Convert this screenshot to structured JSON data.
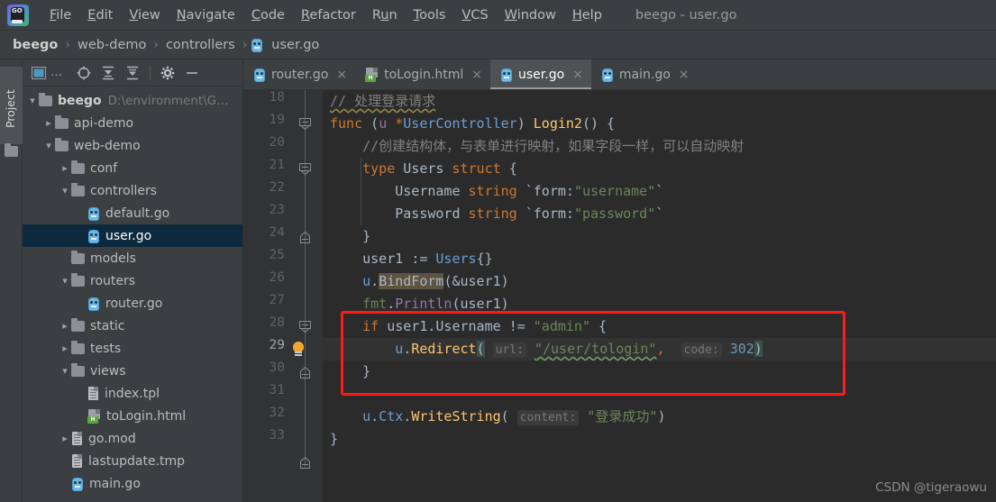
{
  "window": {
    "title": "beego - user.go",
    "app_icon": "goland-logo-icon"
  },
  "menubar": {
    "items": [
      {
        "label": "File",
        "mnemonic": "F"
      },
      {
        "label": "Edit",
        "mnemonic": "E"
      },
      {
        "label": "View",
        "mnemonic": "V"
      },
      {
        "label": "Navigate",
        "mnemonic": "N"
      },
      {
        "label": "Code",
        "mnemonic": "C"
      },
      {
        "label": "Refactor",
        "mnemonic": "R"
      },
      {
        "label": "Run",
        "mnemonic": "u"
      },
      {
        "label": "Tools",
        "mnemonic": "T"
      },
      {
        "label": "VCS",
        "mnemonic": "V"
      },
      {
        "label": "Window",
        "mnemonic": "W"
      },
      {
        "label": "Help",
        "mnemonic": "H"
      }
    ]
  },
  "breadcrumb": {
    "separator": "›",
    "items": [
      {
        "label": "beego",
        "icon": null
      },
      {
        "label": "web-demo",
        "icon": null
      },
      {
        "label": "controllers",
        "icon": null
      },
      {
        "label": "user.go",
        "icon": "go-file-icon"
      }
    ]
  },
  "project_pane": {
    "vertical_tab_label": "Project",
    "toolbar": [
      {
        "name": "project-view-selector",
        "label": "■",
        "extra": "..."
      },
      {
        "name": "locate-in-tree",
        "label": "target-icon"
      },
      {
        "name": "expand-all",
        "label": "expand-all-icon"
      },
      {
        "name": "collapse-all",
        "label": "collapse-all-icon"
      },
      {
        "name": "settings",
        "label": "gear-icon"
      },
      {
        "name": "hide",
        "label": "minimize-icon"
      }
    ],
    "tree": [
      {
        "label": "beego",
        "path": "D:\\environment\\G…",
        "icon": "folder-icon",
        "depth": 0,
        "arrow": "expanded",
        "bold": true,
        "selected": false
      },
      {
        "label": "api-demo",
        "path": "",
        "icon": "folder-icon",
        "depth": 1,
        "arrow": "collapsed",
        "bold": false,
        "selected": false
      },
      {
        "label": "web-demo",
        "path": "",
        "icon": "folder-icon",
        "depth": 1,
        "arrow": "expanded",
        "bold": false,
        "selected": false
      },
      {
        "label": "conf",
        "path": "",
        "icon": "folder-icon",
        "depth": 2,
        "arrow": "collapsed",
        "bold": false,
        "selected": false
      },
      {
        "label": "controllers",
        "path": "",
        "icon": "folder-icon",
        "depth": 2,
        "arrow": "expanded",
        "bold": false,
        "selected": false
      },
      {
        "label": "default.go",
        "path": "",
        "icon": "go-file-icon",
        "depth": 3,
        "arrow": "none",
        "bold": false,
        "selected": false
      },
      {
        "label": "user.go",
        "path": "",
        "icon": "go-file-icon",
        "depth": 3,
        "arrow": "none",
        "bold": false,
        "selected": true
      },
      {
        "label": "models",
        "path": "",
        "icon": "folder-icon",
        "depth": 2,
        "arrow": "none",
        "bold": false,
        "selected": false
      },
      {
        "label": "routers",
        "path": "",
        "icon": "folder-icon",
        "depth": 2,
        "arrow": "expanded",
        "bold": false,
        "selected": false
      },
      {
        "label": "router.go",
        "path": "",
        "icon": "go-file-icon",
        "depth": 3,
        "arrow": "none",
        "bold": false,
        "selected": false
      },
      {
        "label": "static",
        "path": "",
        "icon": "folder-icon",
        "depth": 2,
        "arrow": "collapsed",
        "bold": false,
        "selected": false
      },
      {
        "label": "tests",
        "path": "",
        "icon": "folder-icon",
        "depth": 2,
        "arrow": "collapsed",
        "bold": false,
        "selected": false
      },
      {
        "label": "views",
        "path": "",
        "icon": "folder-icon",
        "depth": 2,
        "arrow": "expanded",
        "bold": false,
        "selected": false
      },
      {
        "label": "index.tpl",
        "path": "",
        "icon": "txt-file-icon",
        "depth": 3,
        "arrow": "none",
        "bold": false,
        "selected": false
      },
      {
        "label": "toLogin.html",
        "path": "",
        "icon": "html-file-icon",
        "depth": 3,
        "arrow": "none",
        "bold": false,
        "selected": false
      },
      {
        "label": "go.mod",
        "path": "",
        "icon": "txt-file-icon",
        "depth": 2,
        "arrow": "collapsed",
        "bold": false,
        "selected": false
      },
      {
        "label": "lastupdate.tmp",
        "path": "",
        "icon": "txt-file-icon",
        "depth": 2,
        "arrow": "none",
        "bold": false,
        "selected": false
      },
      {
        "label": "main.go",
        "path": "",
        "icon": "go-file-icon",
        "depth": 2,
        "arrow": "none",
        "bold": false,
        "selected": false
      }
    ]
  },
  "editor_tabs": [
    {
      "label": "router.go",
      "icon": "go-file-icon",
      "active": false,
      "close": "×"
    },
    {
      "label": "toLogin.html",
      "icon": "html-file-icon",
      "active": false,
      "close": "×"
    },
    {
      "label": "user.go",
      "icon": "go-file-icon",
      "active": true,
      "close": "×"
    },
    {
      "label": "main.go",
      "icon": "go-file-icon",
      "active": false,
      "close": "×"
    }
  ],
  "editor": {
    "current_line": 29,
    "line_numbers": [
      18,
      19,
      20,
      21,
      22,
      23,
      24,
      25,
      26,
      27,
      28,
      29,
      30,
      31,
      32,
      33
    ],
    "lines": {
      "18": "// 处理登录请求",
      "19": "func (u *UserController) Login2() {",
      "20": "    //创建结构体，与表单进行映射，如果字段一样，可以自动映射",
      "21": "    type Users struct {",
      "22": "        Username string `form:\"username\"`",
      "23": "        Password string `form:\"password\"`",
      "24": "    }",
      "25": "    user1 := Users{}",
      "26": "    u.BindForm(&user1)",
      "27": "    fmt.Println(user1)",
      "28": "    if user1.Username != \"admin\" {",
      "29": "        u.Redirect( url: \"/user/tologin\",  code: 302)",
      "30": "    }",
      "31": "",
      "32": "    u.Ctx.WriteString( content: \"登录成功\")",
      "33": "}"
    },
    "tokens": {
      "comment_18": "// 处理登录请求",
      "kw_func": "func",
      "recv_u": "u",
      "star": "*",
      "type_usercontroller": "UserController",
      "method_login2": "Login2",
      "comment_20": "//创建结构体，与表单进行映射，如果字段一样，可以自动映射",
      "kw_type": "type",
      "type_users": "Users",
      "kw_struct": "struct",
      "field_username": "Username",
      "field_password": "Password",
      "kw_string": "string",
      "tag_username": "`form:\"username\"`",
      "tag_password": "`form:\"password\"`",
      "var_user1": "user1",
      "assign": ":=",
      "call_bindform": "BindForm",
      "pkg_fmt": "fmt",
      "fn_println": "Println",
      "kw_if": "if",
      "expr_username": "user1.Username",
      "op_neq": "!=",
      "str_admin": "\"admin\"",
      "call_redirect": "Redirect",
      "hint_url": "url:",
      "str_tologin": "\"/user/tologin\"",
      "hint_code": "code:",
      "num_302": "302",
      "call_ctx": "Ctx",
      "call_writestring": "WriteString",
      "hint_content": "content:",
      "str_success": "\"登录成功\""
    },
    "annotation": {
      "type": "red-rectangle-highlight",
      "color": "#ff1a1a",
      "covers_lines": "28-30"
    },
    "gutter_hint_icon": "lightbulb-icon"
  },
  "watermark": "CSDN @tigeraowu",
  "colors": {
    "chrome_bg": "#3c3f41",
    "editor_bg": "#2b2b2b",
    "gutter_bg": "#313335",
    "selection_bg": "#0d293e",
    "current_line_bg": "#323232",
    "accent_red": "#ff1a1a",
    "keyword": "#cc7832",
    "string": "#6a8759",
    "number": "#6897bb",
    "function": "#ffc66d",
    "identifier": "#a9b7c6",
    "comment": "#808080"
  }
}
